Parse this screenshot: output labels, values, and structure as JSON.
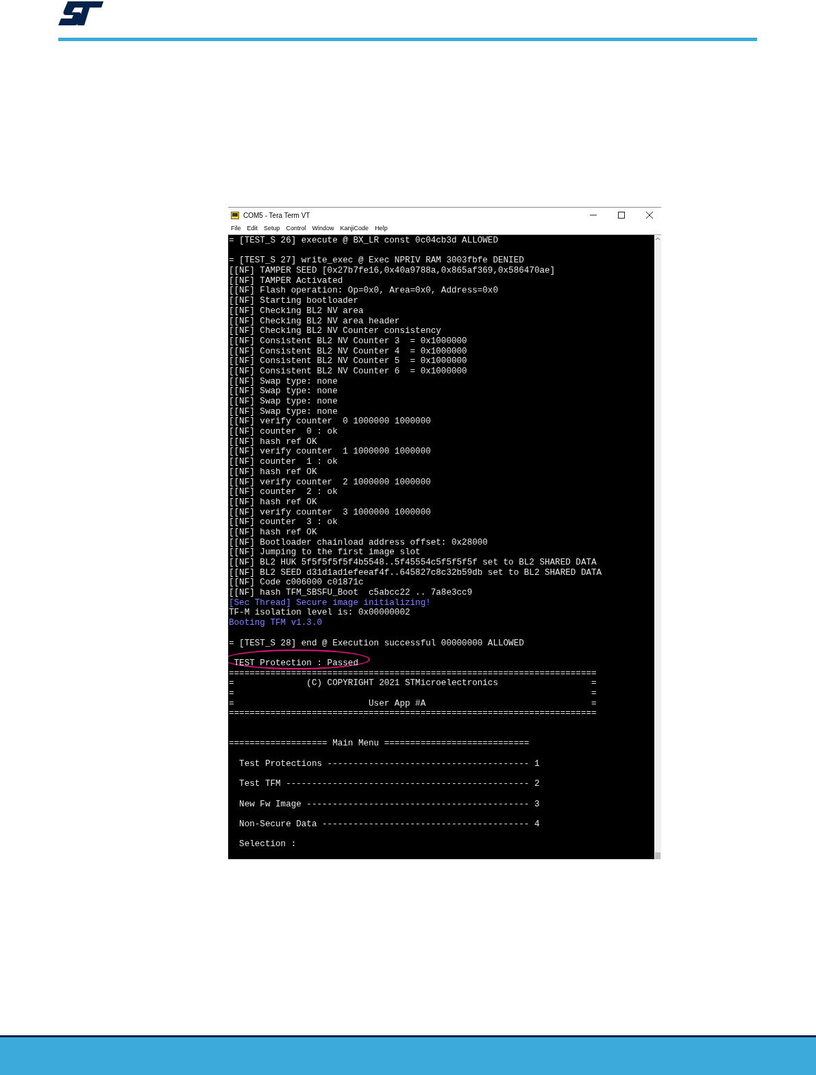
{
  "window": {
    "title": "COM5 - Tera Term VT",
    "menu": [
      "File",
      "Edit",
      "Setup",
      "Control",
      "Window",
      "KanjiCode",
      "Help"
    ]
  },
  "terminal": {
    "lines": [
      {
        "kind": "text",
        "text": "= [TEST_S 26] execute @ BX_LR const 0c04cb3d ALLOWED"
      },
      {
        "kind": "blank"
      },
      {
        "kind": "text",
        "text": "= [TEST_S 27] write_exec @ Exec NPRIV RAM 3003fbfe DENIED"
      },
      {
        "kind": "text",
        "text": "[[NF] TAMPER SEED [0x27b7fe16,0x40a9788a,0x865af369,0x586470ae]"
      },
      {
        "kind": "text",
        "text": "[[NF] TAMPER Activated"
      },
      {
        "kind": "text",
        "text": "[[NF] Flash operation: Op=0x0, Area=0x0, Address=0x0"
      },
      {
        "kind": "text",
        "text": "[[NF] Starting bootloader"
      },
      {
        "kind": "text",
        "text": "[[NF] Checking BL2 NV area"
      },
      {
        "kind": "text",
        "text": "[[NF] Checking BL2 NV area header"
      },
      {
        "kind": "text",
        "text": "[[NF] Checking BL2 NV Counter consistency"
      },
      {
        "kind": "text",
        "text": "[[NF] Consistent BL2 NV Counter 3  = 0x1000000"
      },
      {
        "kind": "text",
        "text": "[[NF] Consistent BL2 NV Counter 4  = 0x1000000"
      },
      {
        "kind": "text",
        "text": "[[NF] Consistent BL2 NV Counter 5  = 0x1000000"
      },
      {
        "kind": "text",
        "text": "[[NF] Consistent BL2 NV Counter 6  = 0x1000000"
      },
      {
        "kind": "text",
        "text": "[[NF] Swap type: none"
      },
      {
        "kind": "text",
        "text": "[[NF] Swap type: none"
      },
      {
        "kind": "text",
        "text": "[[NF] Swap type: none"
      },
      {
        "kind": "text",
        "text": "[[NF] Swap type: none"
      },
      {
        "kind": "text",
        "text": "[[NF] verify counter  0 1000000 1000000"
      },
      {
        "kind": "text",
        "text": "[[NF] counter  0 : ok"
      },
      {
        "kind": "text",
        "text": "[[NF] hash ref OK"
      },
      {
        "kind": "text",
        "text": "[[NF] verify counter  1 1000000 1000000"
      },
      {
        "kind": "text",
        "text": "[[NF] counter  1 : ok"
      },
      {
        "kind": "text",
        "text": "[[NF] hash ref OK"
      },
      {
        "kind": "text",
        "text": "[[NF] verify counter  2 1000000 1000000"
      },
      {
        "kind": "text",
        "text": "[[NF] counter  2 : ok"
      },
      {
        "kind": "text",
        "text": "[[NF] hash ref OK"
      },
      {
        "kind": "text",
        "text": "[[NF] verify counter  3 1000000 1000000"
      },
      {
        "kind": "text",
        "text": "[[NF] counter  3 : ok"
      },
      {
        "kind": "text",
        "text": "[[NF] hash ref OK"
      },
      {
        "kind": "text",
        "text": "[[NF] Bootloader chainload address offset: 0x28000"
      },
      {
        "kind": "text",
        "text": "[[NF] Jumping to the first image slot"
      },
      {
        "kind": "text",
        "text": "[[NF] BL2 HUK 5f5f5f5f5f4b5548..5f45554c5f5f5f5f set to BL2 SHARED DATA"
      },
      {
        "kind": "text",
        "text": "[[NF] BL2 SEED d31d1ad1efeeaf4f..645827c8c32b59db set to BL2 SHARED DATA"
      },
      {
        "kind": "text",
        "text": "[[NF] Code c006000 c01871c"
      },
      {
        "kind": "text",
        "text": "[[NF] hash TFM_SBSFU_Boot  c5abcc22 .. 7a8e3cc9"
      },
      {
        "kind": "blue",
        "text": "[Sec Thread] Secure image initializing!"
      },
      {
        "kind": "text",
        "text": "TF-M isolation level is: 0x00000002"
      },
      {
        "kind": "blue",
        "text": "Booting TFM v1.3.0"
      },
      {
        "kind": "blank"
      },
      {
        "kind": "text",
        "text": "= [TEST_S 28] end @ Execution successful 00000000 ALLOWED"
      },
      {
        "kind": "blank"
      },
      {
        "kind": "circled",
        "text": " TEST Protection : Passed"
      },
      {
        "kind": "text",
        "text": "======================================================================="
      },
      {
        "kind": "text",
        "text": "=              (C) COPYRIGHT 2021 STMicroelectronics                  ="
      },
      {
        "kind": "text",
        "text": "=                                                                     ="
      },
      {
        "kind": "text",
        "text": "=                          User App #A                                ="
      },
      {
        "kind": "text",
        "text": "======================================================================="
      },
      {
        "kind": "blank"
      },
      {
        "kind": "blank"
      },
      {
        "kind": "text",
        "text": "=================== Main Menu ============================"
      },
      {
        "kind": "blank"
      },
      {
        "kind": "text",
        "text": "  Test Protections --------------------------------------- 1"
      },
      {
        "kind": "blank"
      },
      {
        "kind": "text",
        "text": "  Test TFM ----------------------------------------------- 2"
      },
      {
        "kind": "blank"
      },
      {
        "kind": "text",
        "text": "  New Fw Image ------------------------------------------- 3"
      },
      {
        "kind": "blank"
      },
      {
        "kind": "text",
        "text": "  Non-Secure Data ---------------------------------------- 4"
      },
      {
        "kind": "blank"
      },
      {
        "kind": "text",
        "text": "  Selection :"
      }
    ]
  }
}
